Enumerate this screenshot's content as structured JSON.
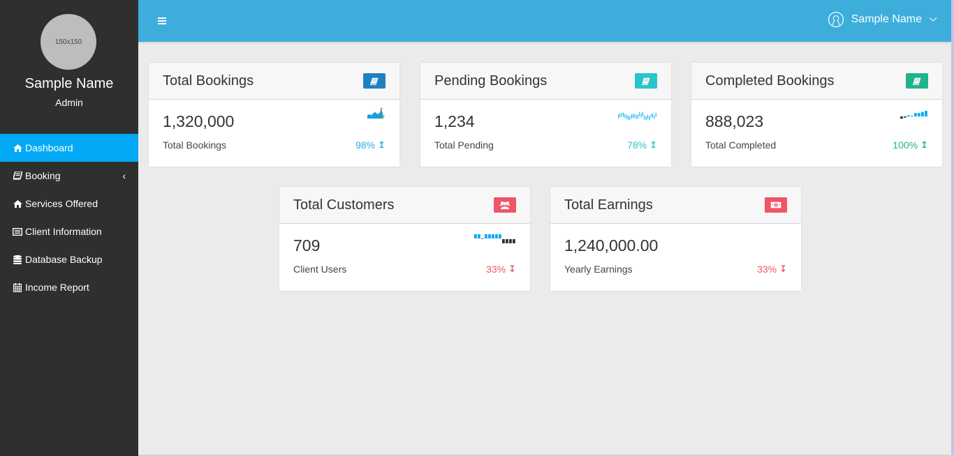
{
  "sidebar": {
    "avatar_placeholder": "150x150",
    "profile_name": "Sample Name",
    "profile_role": "Admin",
    "items": [
      {
        "label": "Dashboard",
        "icon": "home-icon",
        "active": true
      },
      {
        "label": "Booking",
        "icon": "book-icon",
        "has_submenu": true
      },
      {
        "label": "Services Offered",
        "icon": "home-icon"
      },
      {
        "label": "Client Information",
        "icon": "list-alt-icon"
      },
      {
        "label": "Database Backup",
        "icon": "database-icon"
      },
      {
        "label": "Income Report",
        "icon": "calendar-icon"
      }
    ],
    "submenu_chevron": "‹"
  },
  "header": {
    "menu_icon": "hamburger-icon",
    "user_name": "Sample Name",
    "user_icon": "user-circle-icon",
    "dropdown_icon": "chevron-down-icon"
  },
  "colors": {
    "header": "#3daedb",
    "sidebar": "#2f2f2f",
    "active": "#03a9f4",
    "blue": "#1f80c6",
    "teal": "#27c6c9",
    "green": "#1fb48e",
    "red": "#ef5566",
    "up_blue": "#29a9e8",
    "up_teal": "#2bc3c5",
    "up_green": "#1fb48e",
    "down_red": "#ef5566"
  },
  "cards": [
    {
      "title": "Total Bookings",
      "value": "1,320,000",
      "subtitle": "Total Bookings",
      "trend": "98%",
      "trend_dir": "up",
      "icon": "book-icon",
      "badge_color": "#1f80c6",
      "trend_color": "#29a9e8",
      "spark": {
        "type": "area",
        "values": [
          3,
          4,
          3,
          5,
          6,
          4,
          5,
          9,
          2
        ]
      }
    },
    {
      "title": "Pending Bookings",
      "value": "1,234",
      "subtitle": "Total Pending",
      "trend": "78%",
      "trend_dir": "up",
      "icon": "book-icon",
      "badge_color": "#27c6c9",
      "trend_color": "#2bc3c5",
      "spark": {
        "type": "candles",
        "values": [
          5,
          7,
          8,
          8,
          6,
          4,
          3,
          2,
          5,
          6,
          6,
          4,
          5,
          9,
          7,
          9,
          3,
          2,
          4,
          2,
          6,
          7,
          4,
          8
        ]
      }
    },
    {
      "title": "Completed Bookings",
      "value": "888,023",
      "subtitle": "Total Completed",
      "trend": "100%",
      "trend_dir": "up",
      "icon": "book-icon",
      "badge_color": "#1fb48e",
      "trend_color": "#1fb48e",
      "spark": {
        "type": "bar",
        "values": [
          -2,
          -1,
          1,
          0.3,
          3,
          3,
          4,
          5
        ],
        "colors": [
          "#333",
          "#333",
          "#03a9f4",
          "#03a9f4",
          "#03a9f4",
          "#03a9f4",
          "#03a9f4",
          "#03a9f4"
        ]
      }
    },
    {
      "title": "Total Customers",
      "value": "709",
      "subtitle": "Client Users",
      "trend": "33%",
      "trend_dir": "down",
      "icon": "users-icon",
      "badge_color": "#ef5566",
      "trend_color": "#ef5566",
      "spark": {
        "type": "tristate",
        "values": [
          1,
          1,
          0,
          1,
          1,
          1,
          1,
          1,
          -1,
          -1,
          -1,
          -1
        ]
      }
    },
    {
      "title": "Total Earnings",
      "value": "1,240,000.00",
      "subtitle": "Yearly Earnings",
      "trend": "33%",
      "trend_dir": "down",
      "icon": "money-icon",
      "badge_color": "#ef5566",
      "trend_color": "#ef5566",
      "spark": null
    }
  ]
}
